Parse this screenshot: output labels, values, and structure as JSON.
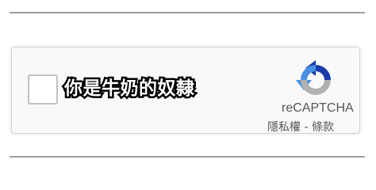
{
  "captcha": {
    "checkbox_label": "你是牛奶的奴隸",
    "brand": "reCAPTCHA",
    "privacy_link": "隱私權",
    "separator": " - ",
    "terms_link": "條款",
    "logo_icon": "recaptcha-logo-icon",
    "colors": {
      "logo_blue": "#1c3aa9",
      "logo_light_blue": "#4a90e2",
      "logo_gray": "#b1b1b1",
      "widget_background": "#f9f9f9",
      "border": "#d3d3d3"
    }
  }
}
